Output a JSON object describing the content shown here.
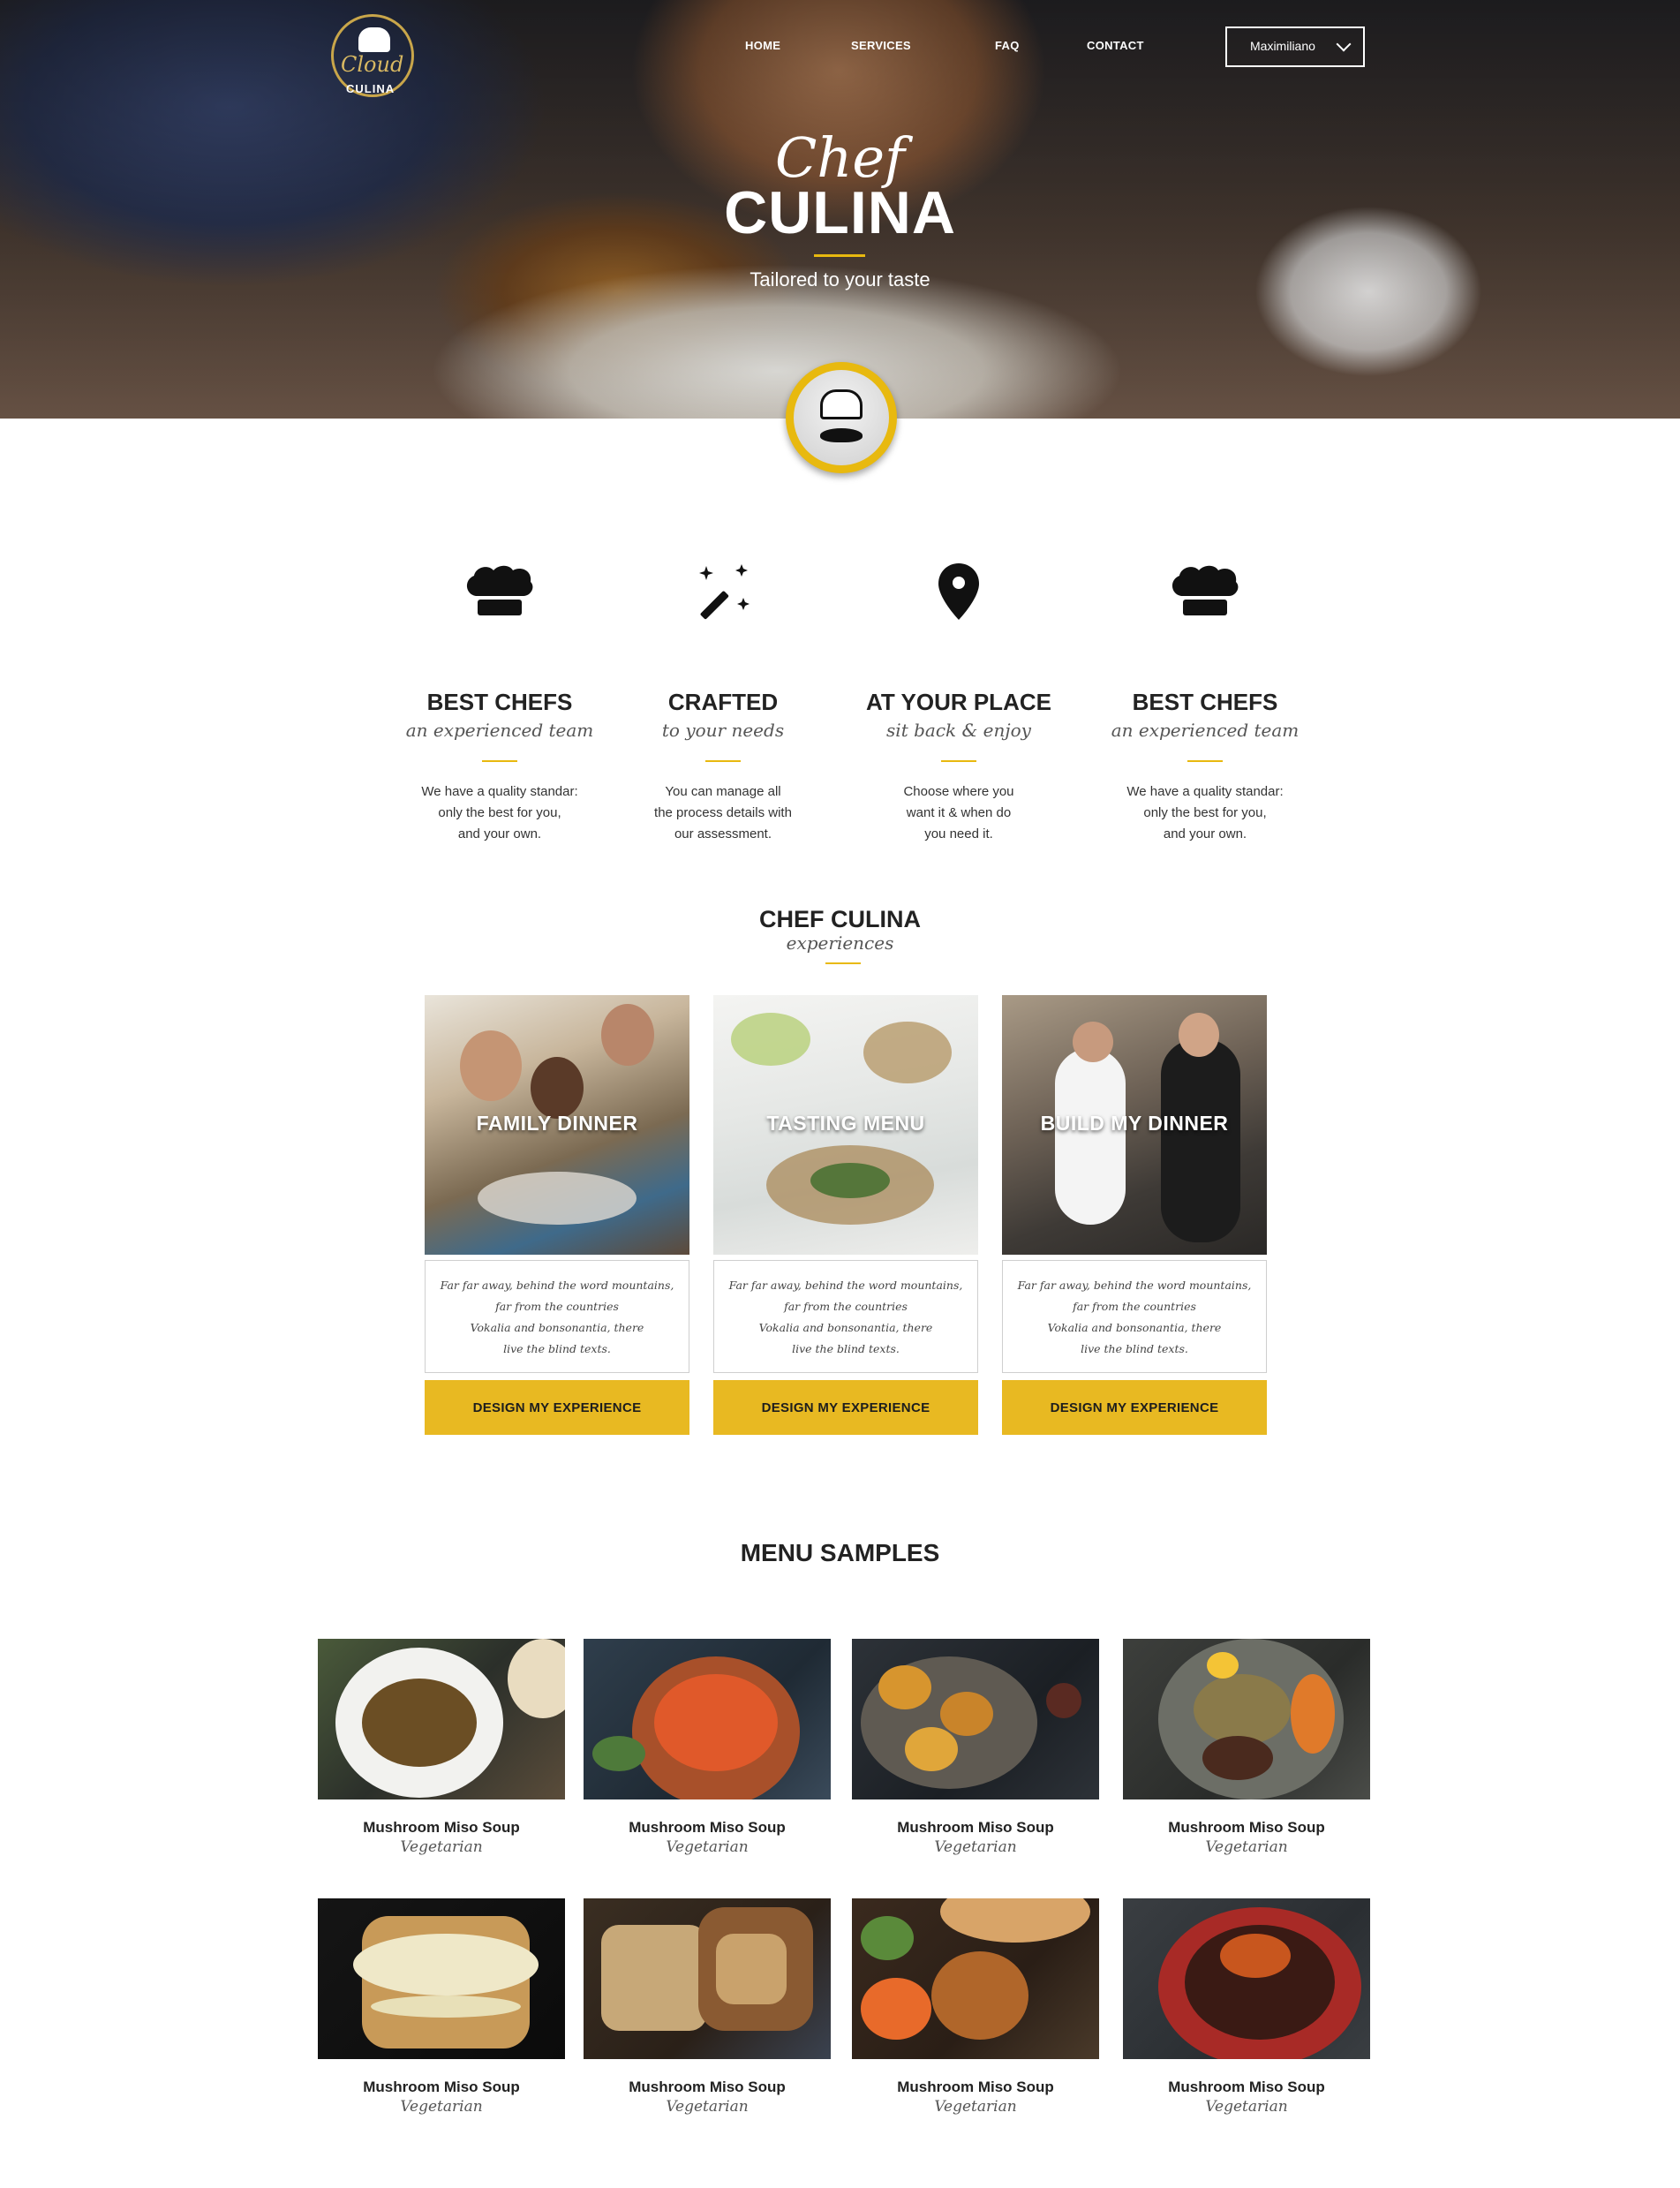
{
  "header": {
    "logo_script": "Cloud",
    "logo_word": "CULINA",
    "nav": [
      "HOME",
      "SERVICES",
      "FAQ",
      "CONTACT"
    ],
    "user_name": "Maximiliano"
  },
  "hero": {
    "script_title": "Chef",
    "title": "CULINA",
    "tagline": "Tailored to your taste"
  },
  "features": [
    {
      "icon": "chef-hat-icon",
      "title": "BEST CHEFS",
      "subtitle": "an experienced team",
      "lines": [
        "We have a quality standar:",
        "only the best for you,",
        "and your own."
      ]
    },
    {
      "icon": "magic-wand-icon",
      "title": "CRAFTED",
      "subtitle": "to your needs",
      "lines": [
        "You can manage all",
        "the process details with",
        "our assessment."
      ]
    },
    {
      "icon": "location-pin-icon",
      "title": "AT YOUR PLACE",
      "subtitle": "sit back & enjoy",
      "lines": [
        "Choose where you",
        "want it & when do",
        "you need it."
      ]
    },
    {
      "icon": "chef-hat-icon",
      "title": "BEST CHEFS",
      "subtitle": "an experienced team",
      "lines": [
        "We have a quality standar:",
        "only the best for you,",
        "and your own."
      ]
    }
  ],
  "experiences": {
    "title": "CHEF CULINA",
    "subtitle": "experiences",
    "cards": [
      {
        "label": "FAMILY DINNER",
        "lines": [
          "Far far away, behind the word mountains,",
          "far from the countries",
          "Vokalia and bonsonantia, there",
          "live the blind texts."
        ],
        "button": "DESIGN MY EXPERIENCE"
      },
      {
        "label": "TASTING MENU",
        "lines": [
          "Far far away, behind the word mountains,",
          "far from the countries",
          "Vokalia and bonsonantia, there",
          "live the blind texts."
        ],
        "button": "DESIGN MY EXPERIENCE"
      },
      {
        "label": "BUILD MY DINNER",
        "lines": [
          "Far far away, behind the word mountains,",
          "far from the countries",
          "Vokalia and bonsonantia, there",
          "live the blind texts."
        ],
        "button": "DESIGN MY EXPERIENCE"
      }
    ]
  },
  "menu": {
    "title": "MENU SAMPLES",
    "items": [
      {
        "name": "Mushroom Miso Soup",
        "type": "Vegetarian"
      },
      {
        "name": "Mushroom Miso Soup",
        "type": "Vegetarian"
      },
      {
        "name": "Mushroom Miso Soup",
        "type": "Vegetarian"
      },
      {
        "name": "Mushroom Miso Soup",
        "type": "Vegetarian"
      },
      {
        "name": "Mushroom Miso Soup",
        "type": "Vegetarian"
      },
      {
        "name": "Mushroom Miso Soup",
        "type": "Vegetarian"
      },
      {
        "name": "Mushroom Miso Soup",
        "type": "Vegetarian"
      },
      {
        "name": "Mushroom Miso Soup",
        "type": "Vegetarian"
      }
    ]
  },
  "colors": {
    "accent": "#e8b922",
    "text": "#222222"
  }
}
